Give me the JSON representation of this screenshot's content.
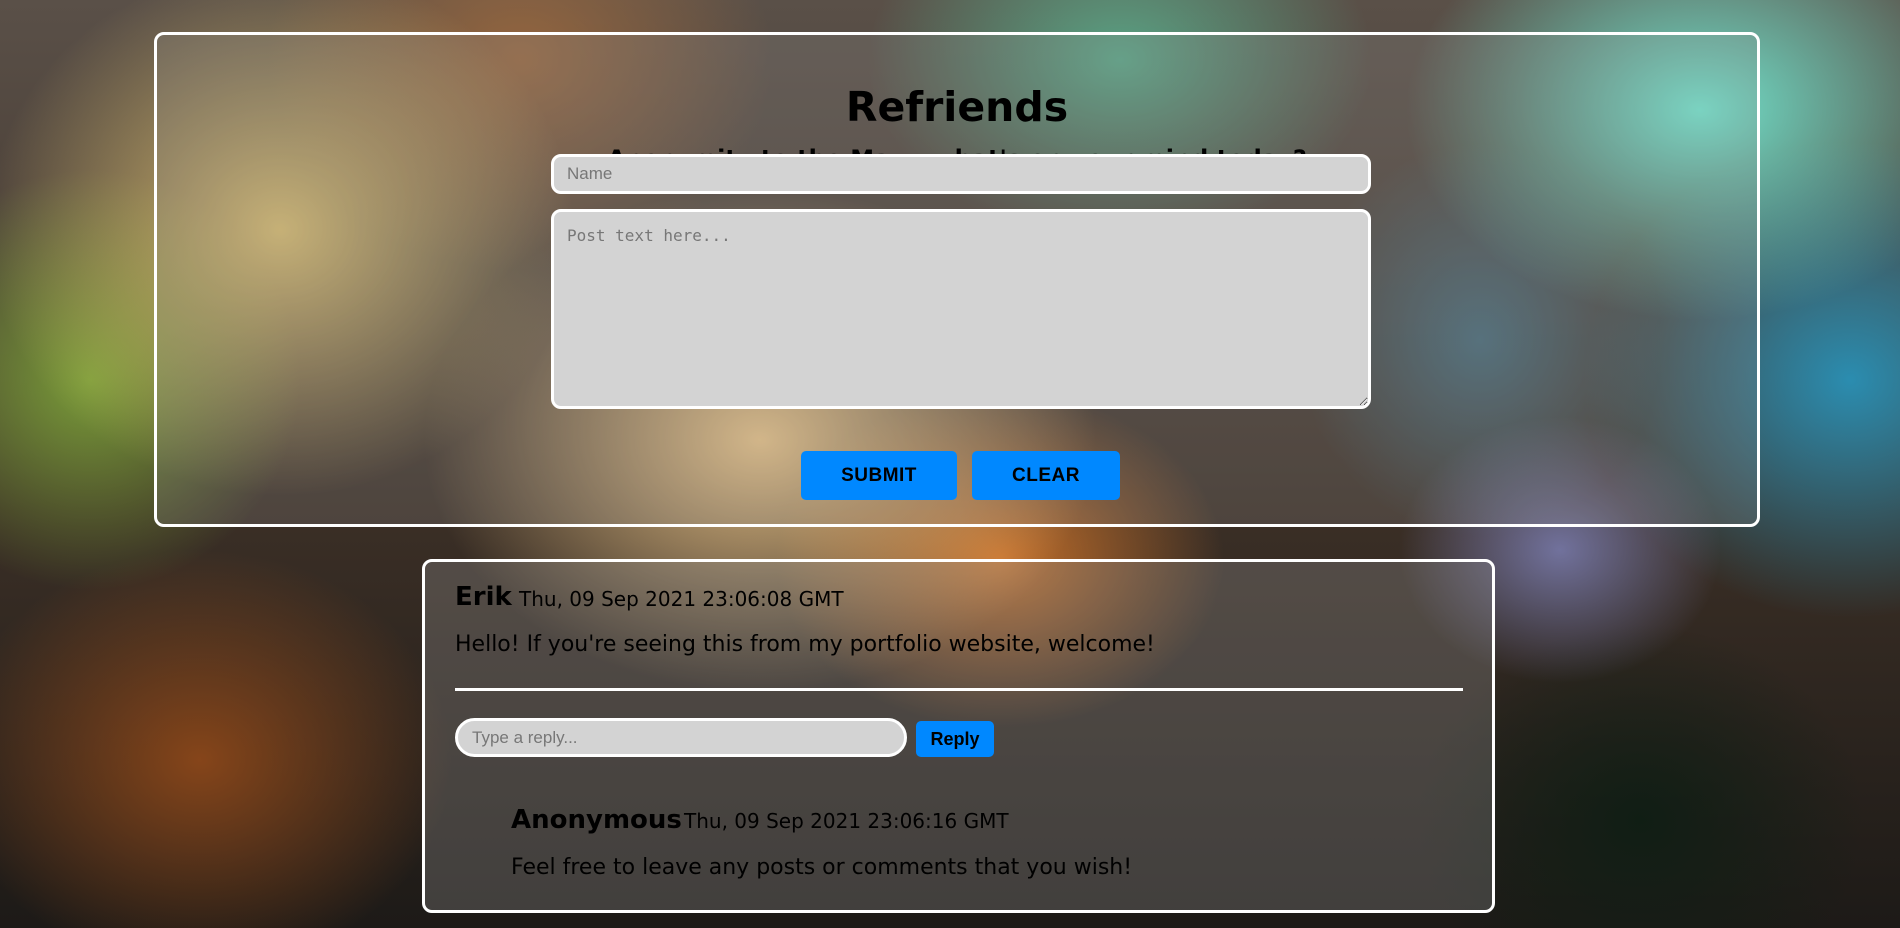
{
  "header": {
    "title": "Refriends",
    "tagline": "Anonymity to the Max - what's on your mind today?",
    "name_placeholder": "Name",
    "post_placeholder": "Post text here...",
    "submit_label": "SUBMIT",
    "clear_label": "CLEAR"
  },
  "posts": [
    {
      "author": "Erik",
      "timestamp": "Thu, 09 Sep 2021 23:06:08 GMT",
      "body": "Hello! If you're seeing this from my portfolio website, welcome!",
      "reply_placeholder": "Type a reply...",
      "reply_label": "Reply",
      "replies": [
        {
          "author": "Anonymous",
          "timestamp": "Thu, 09 Sep 2021 23:06:16 GMT",
          "body": "Feel free to leave any posts or comments that you wish!"
        }
      ]
    }
  ],
  "colors": {
    "button": "#0088ff",
    "input_bg": "#d3d3d3",
    "border": "#ffffff"
  }
}
